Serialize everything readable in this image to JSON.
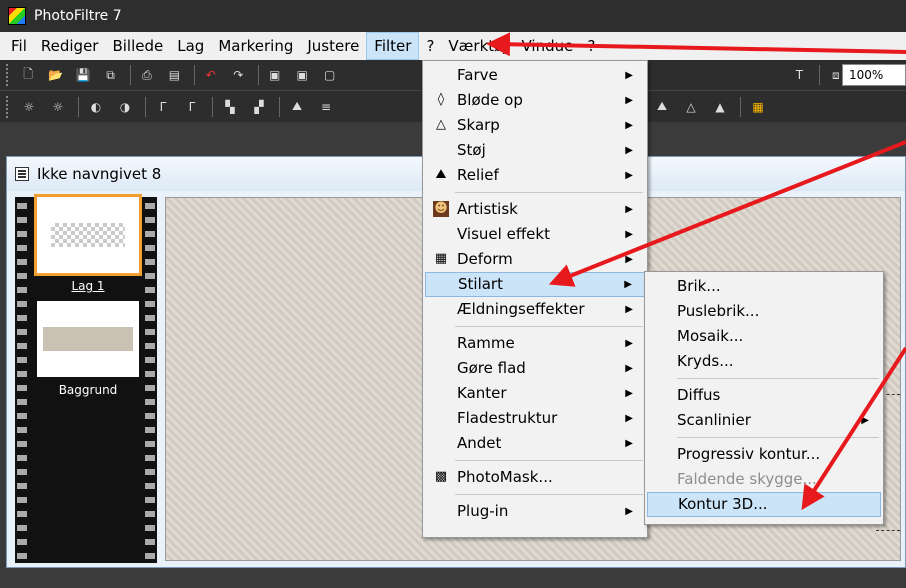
{
  "window": {
    "title": "PhotoFiltre 7"
  },
  "menubar": [
    "Fil",
    "Rediger",
    "Billede",
    "Lag",
    "Markering",
    "Justere",
    "Filter",
    "?",
    "Værktøj",
    "Vindue",
    "?"
  ],
  "toolbar": {
    "zoom": "100%"
  },
  "document": {
    "title": "Ikke navngivet 8",
    "layers": [
      {
        "name": "Lag 1",
        "selected": true
      },
      {
        "name": "Baggrund",
        "selected": false
      }
    ]
  },
  "filter_menu": {
    "groups": [
      [
        {
          "label": "Farve",
          "icon": "",
          "submenu": true
        },
        {
          "label": "Bløde op",
          "icon": "drop-icon",
          "submenu": true
        },
        {
          "label": "Skarp",
          "icon": "triangle-icon",
          "submenu": true
        },
        {
          "label": "Støj",
          "icon": "",
          "submenu": true
        },
        {
          "label": "Relief",
          "icon": "relief-icon",
          "submenu": true
        }
      ],
      [
        {
          "label": "Artistisk",
          "icon": "portrait-icon",
          "submenu": true
        },
        {
          "label": "Visuel effekt",
          "icon": "",
          "submenu": true
        },
        {
          "label": "Deform",
          "icon": "grid-icon",
          "submenu": true
        },
        {
          "label": "Stilart",
          "icon": "",
          "submenu": true,
          "highlighted": true
        },
        {
          "label": "Ældningseffekter",
          "icon": "",
          "submenu": true
        }
      ],
      [
        {
          "label": "Ramme",
          "icon": "",
          "submenu": true
        },
        {
          "label": "Gøre flad",
          "icon": "",
          "submenu": true
        },
        {
          "label": "Kanter",
          "icon": "",
          "submenu": true
        },
        {
          "label": "Fladestruktur",
          "icon": "",
          "submenu": true
        },
        {
          "label": "Andet",
          "icon": "",
          "submenu": true
        }
      ],
      [
        {
          "label": "PhotoMask...",
          "icon": "mask-icon",
          "submenu": false
        }
      ],
      [
        {
          "label": "Plug-in",
          "icon": "",
          "submenu": true
        }
      ]
    ]
  },
  "stilart_menu": {
    "groups": [
      [
        {
          "label": "Brik...",
          "submenu": false
        },
        {
          "label": "Puslebrik...",
          "submenu": false
        },
        {
          "label": "Mosaik...",
          "submenu": false
        },
        {
          "label": "Kryds...",
          "submenu": false
        }
      ],
      [
        {
          "label": "Diffus",
          "submenu": false
        },
        {
          "label": "Scanlinier",
          "submenu": true
        }
      ],
      [
        {
          "label": "Progressiv kontur...",
          "submenu": false
        },
        {
          "label": "Faldende skygge...",
          "submenu": false,
          "disabled": true
        },
        {
          "label": "Kontur 3D...",
          "submenu": false,
          "highlighted": true
        }
      ]
    ]
  },
  "colors": {
    "annotation_arrow": "#e8191d",
    "highlight": "#cce4f7"
  }
}
